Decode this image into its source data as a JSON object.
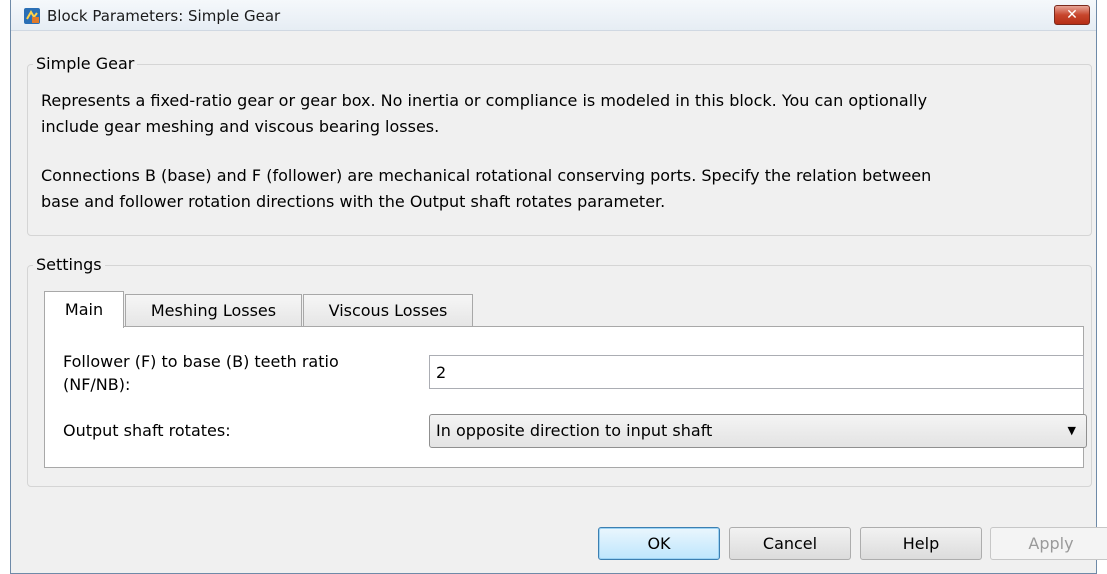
{
  "window": {
    "title": "Block Parameters: Simple Gear",
    "close_symbol": "✕"
  },
  "block": {
    "name": "Simple Gear",
    "description_lines": [
      "Represents a fixed-ratio gear or gear box. No inertia or compliance is modeled in this block. You can optionally",
      "include gear meshing and viscous bearing losses.",
      "Connections B (base) and F (follower) are mechanical rotational conserving ports. Specify the relation between",
      "base and follower rotation directions with the Output shaft rotates parameter."
    ]
  },
  "settings": {
    "legend": "Settings",
    "tabs": [
      "Main",
      "Meshing Losses",
      "Viscous Losses"
    ],
    "active_tab": "Main",
    "fields": {
      "teeth_ratio_label_1": "Follower (F) to base (B) teeth ratio",
      "teeth_ratio_label_2": "(NF/NB):",
      "teeth_ratio_value": "2",
      "output_shaft_label": "Output shaft rotates:",
      "output_shaft_value": "In opposite direction to input shaft",
      "dropdown_arrow": "▼"
    }
  },
  "buttons": {
    "ok": "OK",
    "cancel": "Cancel",
    "help": "Help",
    "apply": "Apply"
  },
  "colors": {
    "close_button": "#c7452c",
    "default_button_border": "#3c7fb1"
  }
}
